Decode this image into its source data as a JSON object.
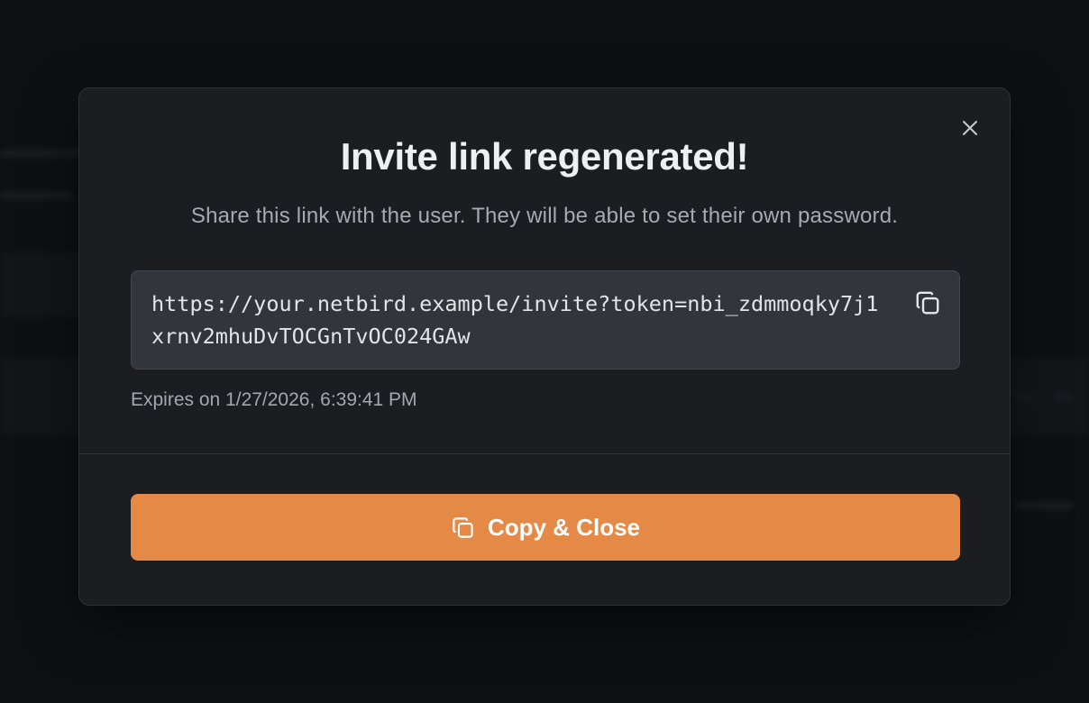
{
  "modal": {
    "title": "Invite link regenerated!",
    "subtitle": "Share this link with the user. They will be able to set their own password.",
    "invite_link": "https://your.netbird.example/invite?token=nbi_zdmmoqky7j1xrnv2mhuDvTOCGnTvOC024GAw",
    "expires_text": "Expires on 1/27/2026, 6:39:41 PM",
    "primary_button_label": "Copy & Close",
    "icons": {
      "close": "close-icon",
      "copy_link": "copy-icon",
      "primary_button": "copy-icon"
    }
  },
  "colors": {
    "accent": "#e48946",
    "modal_background": "#1c1d21",
    "link_box_background": "#33353d",
    "page_background": "#121316"
  }
}
